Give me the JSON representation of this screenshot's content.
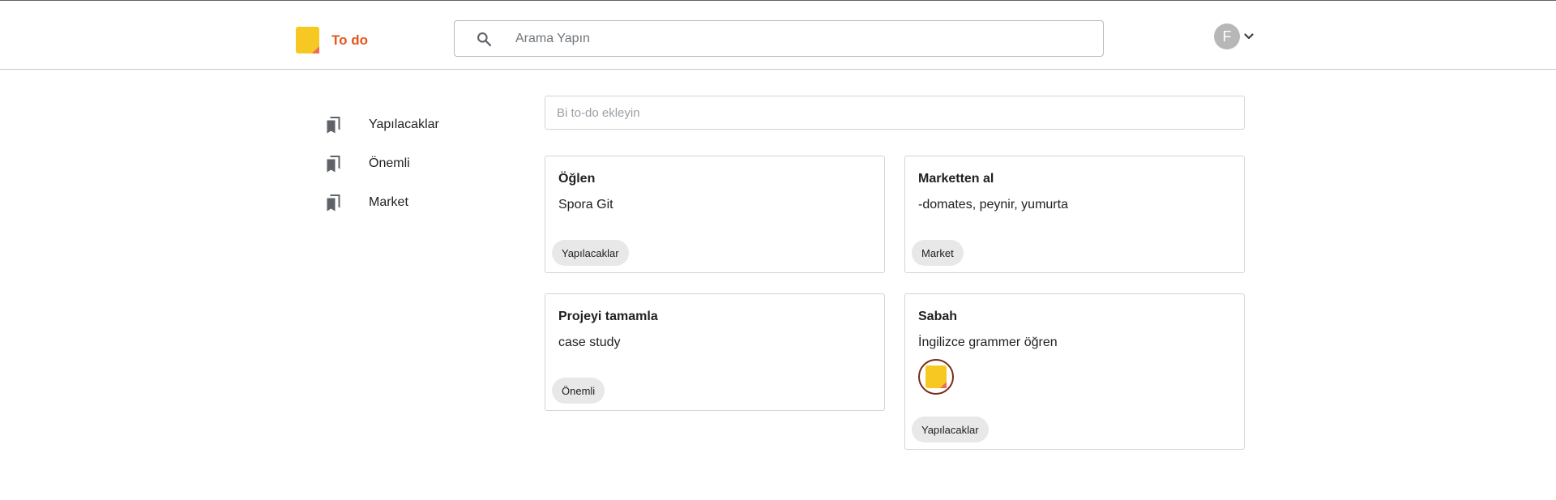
{
  "app": {
    "name": "To do",
    "brand_color": "#e8541c",
    "logo_color": "#f8c822",
    "logo_fold_color": "#f2685a"
  },
  "search": {
    "placeholder": "Arama Yapın",
    "value": "",
    "icon": "search-icon"
  },
  "account": {
    "initial": "F",
    "menu_icon": "chevron-down-icon"
  },
  "sidebar": {
    "items": [
      {
        "label": "Yapılacaklar",
        "icon": "bookmarks-icon"
      },
      {
        "label": "Önemli",
        "icon": "bookmarks-icon"
      },
      {
        "label": "Market",
        "icon": "bookmarks-icon"
      }
    ]
  },
  "new_todo": {
    "placeholder": "Bi to-do ekleyin",
    "value": ""
  },
  "todos": [
    {
      "title": "Öğlen",
      "body": "Spora Git",
      "tag": "Yapılacaklar",
      "has_image": false
    },
    {
      "title": "Marketten al",
      "body": "-domates, peynir, yumurta",
      "tag": "Market",
      "has_image": false
    },
    {
      "title": "Projeyi tamamla",
      "body": "case study",
      "tag": "Önemli",
      "has_image": false
    },
    {
      "title": "Sabah",
      "body": "İngilizce grammer öğren",
      "tag": "Yapılacaklar",
      "has_image": true
    }
  ]
}
